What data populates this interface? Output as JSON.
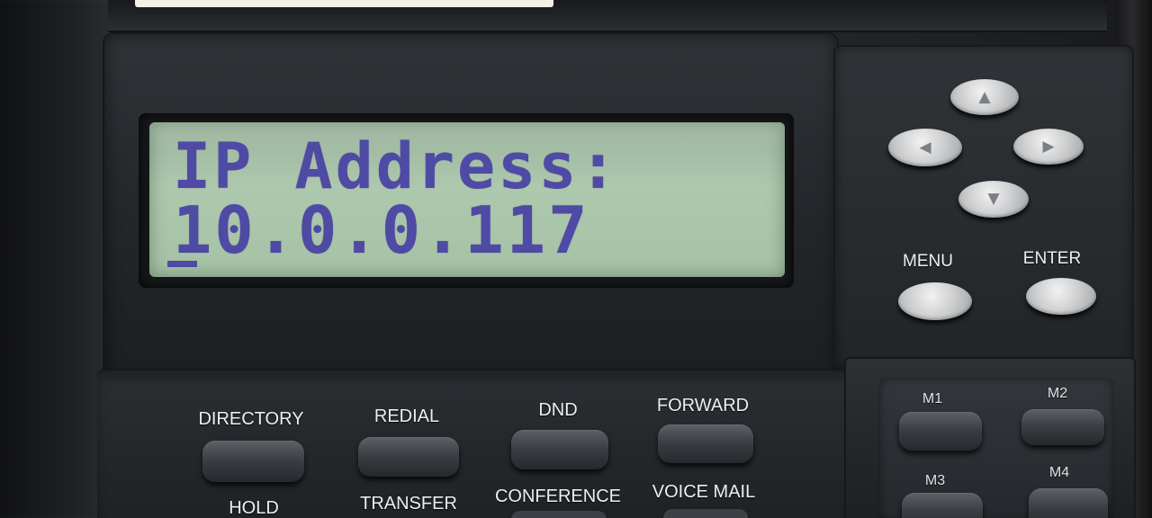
{
  "display": {
    "line1": "IP Address:",
    "line2": "10.0.0.117"
  },
  "navigation": {
    "up_icon": "up-arrow-icon",
    "left_icon": "left-arrow-icon",
    "right_icon": "right-arrow-icon",
    "down_icon": "down-arrow-icon",
    "up_symbol": "▲",
    "left_symbol": "◀",
    "right_symbol": "▶",
    "down_symbol": "▼",
    "menu_label": "MENU",
    "enter_label": "ENTER"
  },
  "function_keys": {
    "top_labels": [
      "DIRECTORY",
      "REDIAL",
      "DND",
      "FORWARD"
    ],
    "bottom_labels": [
      "HOLD",
      "TRANSFER",
      "CONFERENCE",
      "VOICE MAIL"
    ]
  },
  "memory_keys": {
    "labels": [
      "M1",
      "M2",
      "M3",
      "M4"
    ]
  },
  "colors": {
    "lcd_background": "#adc8ad",
    "lcd_text": "#4f4aa4",
    "label_text": "#eceff2"
  }
}
